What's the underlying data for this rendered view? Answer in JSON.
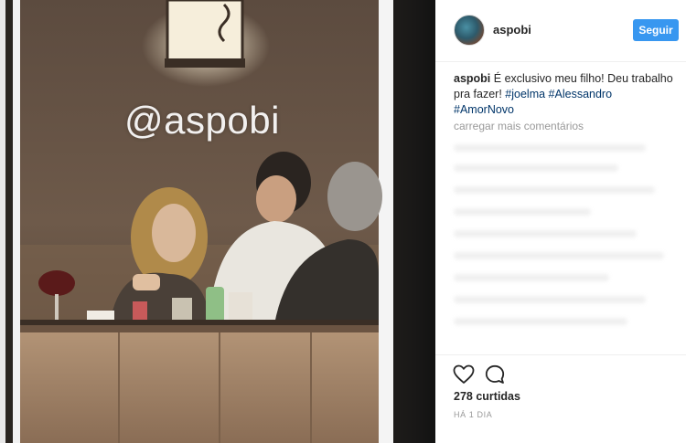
{
  "photo": {
    "watermark": "@aspobi"
  },
  "post": {
    "username": "aspobi",
    "follow_label": "Seguir",
    "caption": {
      "user": "aspobi",
      "text": " É exclusivo meu filho! Deu trabalho pra fazer! ",
      "hashtags": [
        "#joelma",
        "#Alessandro",
        "#AmorNovo"
      ]
    },
    "load_more_label": "carregar mais comentários",
    "likes": "278 curtidas",
    "timestamp": "HÁ 1 DIA"
  },
  "icons": {
    "like": "heart-icon",
    "comment": "comment-icon"
  },
  "colors": {
    "accent": "#3897f0",
    "hashtag": "#003569",
    "muted": "#999999",
    "text": "#262626"
  }
}
